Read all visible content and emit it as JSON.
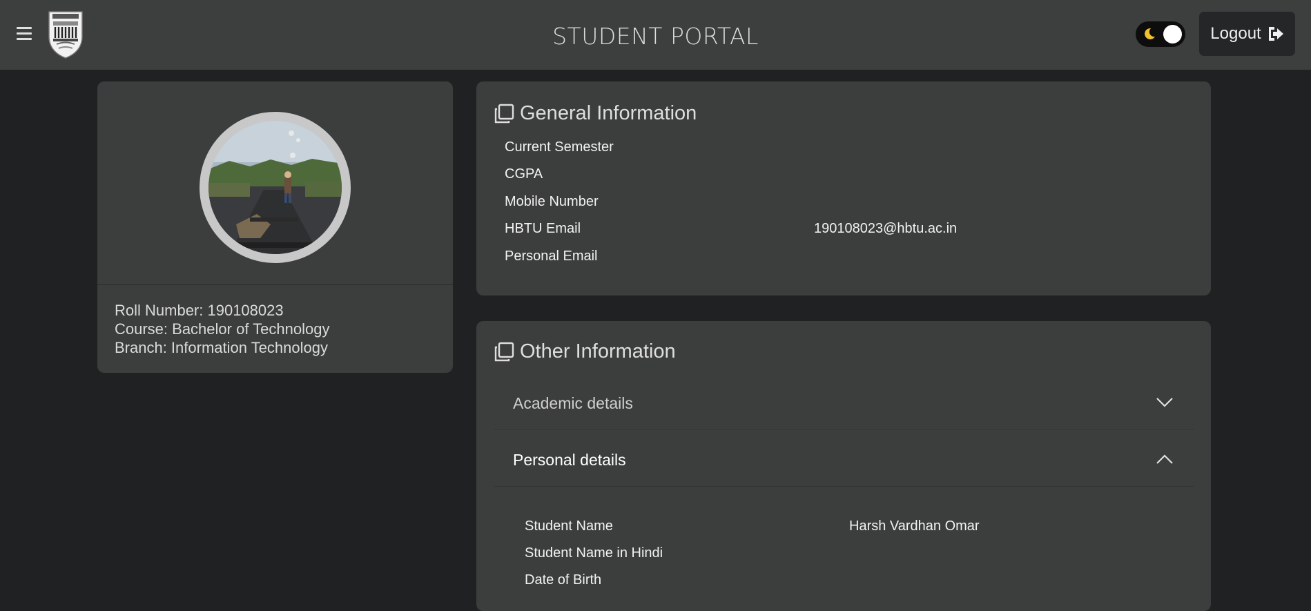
{
  "header": {
    "title": "STUDENT PORTAL",
    "logout_label": "Logout",
    "menu_icon": "hamburger-icon",
    "theme_icon": "moon-icon",
    "logout_icon": "sign-out-icon"
  },
  "profile": {
    "roll_number": "Roll Number: 190108023",
    "course": "Course: Bachelor of Technology",
    "branch": "Branch: Information Technology"
  },
  "general": {
    "title": "General Information",
    "rows": [
      {
        "label": "Current Semester",
        "value": ""
      },
      {
        "label": "CGPA",
        "value": ""
      },
      {
        "label": "Mobile Number",
        "value": ""
      },
      {
        "label": "HBTU Email",
        "value": "190108023@hbtu.ac.in"
      },
      {
        "label": "Personal Email",
        "value": ""
      }
    ]
  },
  "other": {
    "title": "Other Information",
    "sections": [
      {
        "label": "Academic details",
        "expanded": false
      },
      {
        "label": "Personal details",
        "expanded": true
      }
    ],
    "personal_rows": [
      {
        "label": "Student Name",
        "value": "Harsh Vardhan Omar"
      },
      {
        "label": "Student Name in Hindi",
        "value": ""
      },
      {
        "label": "Date of Birth",
        "value": ""
      }
    ]
  },
  "colors": {
    "background": "#202122",
    "header": "#3d3e3e",
    "card": "#3c3d3d",
    "moon": "#f2c12e"
  }
}
